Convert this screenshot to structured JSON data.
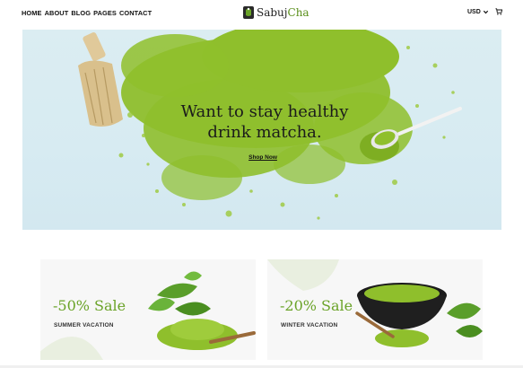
{
  "header": {
    "nav": [
      "HOME",
      "ABOUT",
      "BLOG",
      "PAGES",
      "CONTACT"
    ],
    "logo": {
      "text_main": "Sabuj",
      "text_accent": "Cha"
    },
    "currency": "USD",
    "icons": {
      "currency_toggle": "chevron-down-icon",
      "cart": "cart-icon"
    }
  },
  "hero": {
    "title_line1": "Want to stay healthy",
    "title_line2": "drink matcha.",
    "cta": "Shop Now"
  },
  "promos": [
    {
      "sale": "-50% Sale",
      "subtitle": "SUMMER VACATION"
    },
    {
      "sale": "-20% Sale",
      "subtitle": "WINTER VACATION"
    }
  ],
  "colors": {
    "accent": "#6aa328",
    "matcha": "#8fbf2c",
    "hero_bg": "#d7ebf2",
    "card_bg": "#f7f7f7"
  }
}
